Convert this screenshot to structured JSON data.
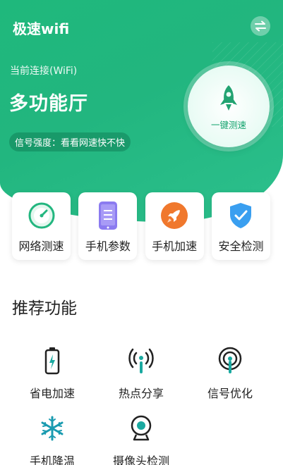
{
  "header": {
    "app_title": "极速wifi"
  },
  "connection": {
    "label": "当前连接(WiFi)",
    "network_name": "多功能厅",
    "signal_text": "信号强度：看看网速快不快"
  },
  "speed_test": {
    "label": "一键测速"
  },
  "tools": [
    {
      "label": "网络测速",
      "icon": "speed-dial-icon"
    },
    {
      "label": "手机参数",
      "icon": "phone-specs-icon"
    },
    {
      "label": "手机加速",
      "icon": "rocket-boost-icon"
    },
    {
      "label": "安全检测",
      "icon": "shield-check-icon"
    }
  ],
  "recommended": {
    "title": "推荐功能",
    "items": [
      {
        "label": "省电加速",
        "icon": "battery-bolt-icon"
      },
      {
        "label": "热点分享",
        "icon": "hotspot-icon"
      },
      {
        "label": "信号优化",
        "icon": "signal-icon"
      },
      {
        "label": "手机降温",
        "icon": "snowflake-icon"
      },
      {
        "label": "摄像头检测",
        "icon": "camera-icon"
      }
    ]
  },
  "colors": {
    "brand_green": "#22b67f",
    "accent_teal": "#1aa9a0",
    "orange": "#f0782d",
    "purple": "#8b7bf0",
    "blue": "#3a9ff0"
  }
}
